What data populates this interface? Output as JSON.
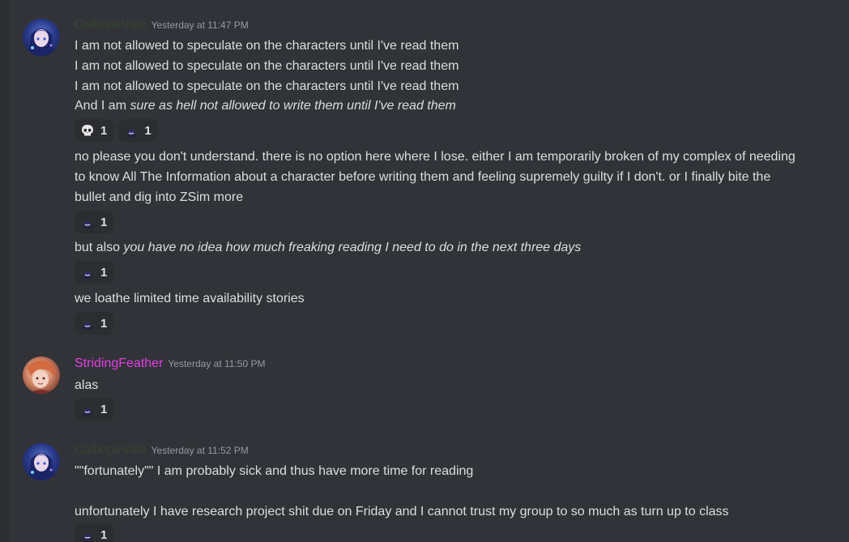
{
  "messages": [
    {
      "author": "CalliopeVale",
      "author_color": "#36452f",
      "timestamp": "Yesterday at 11:47 PM",
      "lines": [
        "I am not allowed to speculate on the characters until I've read them",
        "I am not allowed to speculate on the characters until I've read them",
        "I am not allowed to speculate on the characters until I've read them"
      ],
      "line4_plain": "And I am ",
      "line4_italic": "sure as hell not allowed to write them until I've read them",
      "reactions": [
        {
          "emoji": "skull-emoji",
          "count": "1"
        },
        {
          "emoji": "hat-emoji",
          "count": "1"
        }
      ]
    },
    {
      "text": "no please you don't understand. there is no option here where I lose. either I am temporarily broken of my complex of needing to know All The Information about a character before writing them and feeling supremely guilty if I don't. or I finally bite the bullet and dig into ZSim more",
      "reactions": [
        {
          "emoji": "hat-emoji",
          "count": "1"
        }
      ]
    },
    {
      "plain": "but also ",
      "italic": "you have no idea how much freaking reading I need to do in the next three days",
      "reactions": [
        {
          "emoji": "hat-emoji",
          "count": "1"
        }
      ]
    },
    {
      "text": "we loathe limited time availability stories",
      "reactions": [
        {
          "emoji": "hat-emoji",
          "count": "1"
        }
      ]
    },
    {
      "author": "StridingFeather",
      "author_color": "#e03fe0",
      "timestamp": "Yesterday at 11:50 PM",
      "text": "alas",
      "reactions": [
        {
          "emoji": "hat-emoji",
          "count": "1"
        }
      ]
    },
    {
      "author": "CalliopeVale",
      "author_color": "#36452f",
      "timestamp": "Yesterday at 11:52 PM",
      "lines": [
        "\"\"fortunately\"\" I am probably sick and thus have more time for reading",
        "unfortunately I have research project shit due on Friday and I cannot trust my group to so much as turn up to class"
      ],
      "reactions": [
        {
          "emoji": "hat-emoji",
          "count": "1"
        }
      ]
    }
  ]
}
